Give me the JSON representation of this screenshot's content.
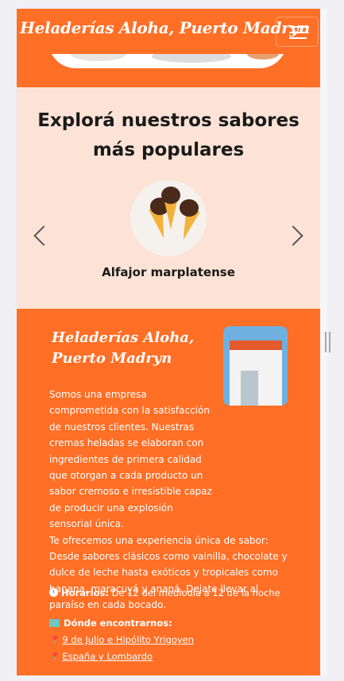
{
  "navbar": {
    "brand": "Heladerías Aloha, Puerto Madryn",
    "menu_icon": "hamburger-icon"
  },
  "flavors": {
    "title_line1": "Explorá nuestros sabores",
    "title_line2": "más populares",
    "current_flavor": "Alfajor marplatense",
    "prev_icon": "chevron-left-icon",
    "next_icon": "chevron-right-icon"
  },
  "about": {
    "title_line1": "Heladerías Aloha,",
    "title_line2": "Puerto Madryn",
    "p1": "Somos una empresa comprometida con la satisfacción de nuestros clientes. Nuestras cremas heladas se elaboran con ingredientes de primera calidad que otorgan a cada producto un sabor cremoso e irresistible capaz de producir una explosión sensorial única.",
    "p2": "Te ofrecemos una experiencia única de sabor: Desde sabores clásicos como vainilla, chocolate y dulce de leche hasta exóticos y tropicales como banana, maracuyá y ananá. Dejate llevar al paraíso en cada bocado.",
    "hours_label": "Horarios:",
    "hours_value": "De 12 del mediodía a 12 de la noche",
    "where_label": "Dónde encontrarnos:",
    "locations": [
      "9 de Julio e Hipólito Yrigoyen",
      "España y Lombardo"
    ]
  },
  "colors": {
    "brand_orange": "#ff6f26",
    "light_peach": "#fde3d6"
  }
}
